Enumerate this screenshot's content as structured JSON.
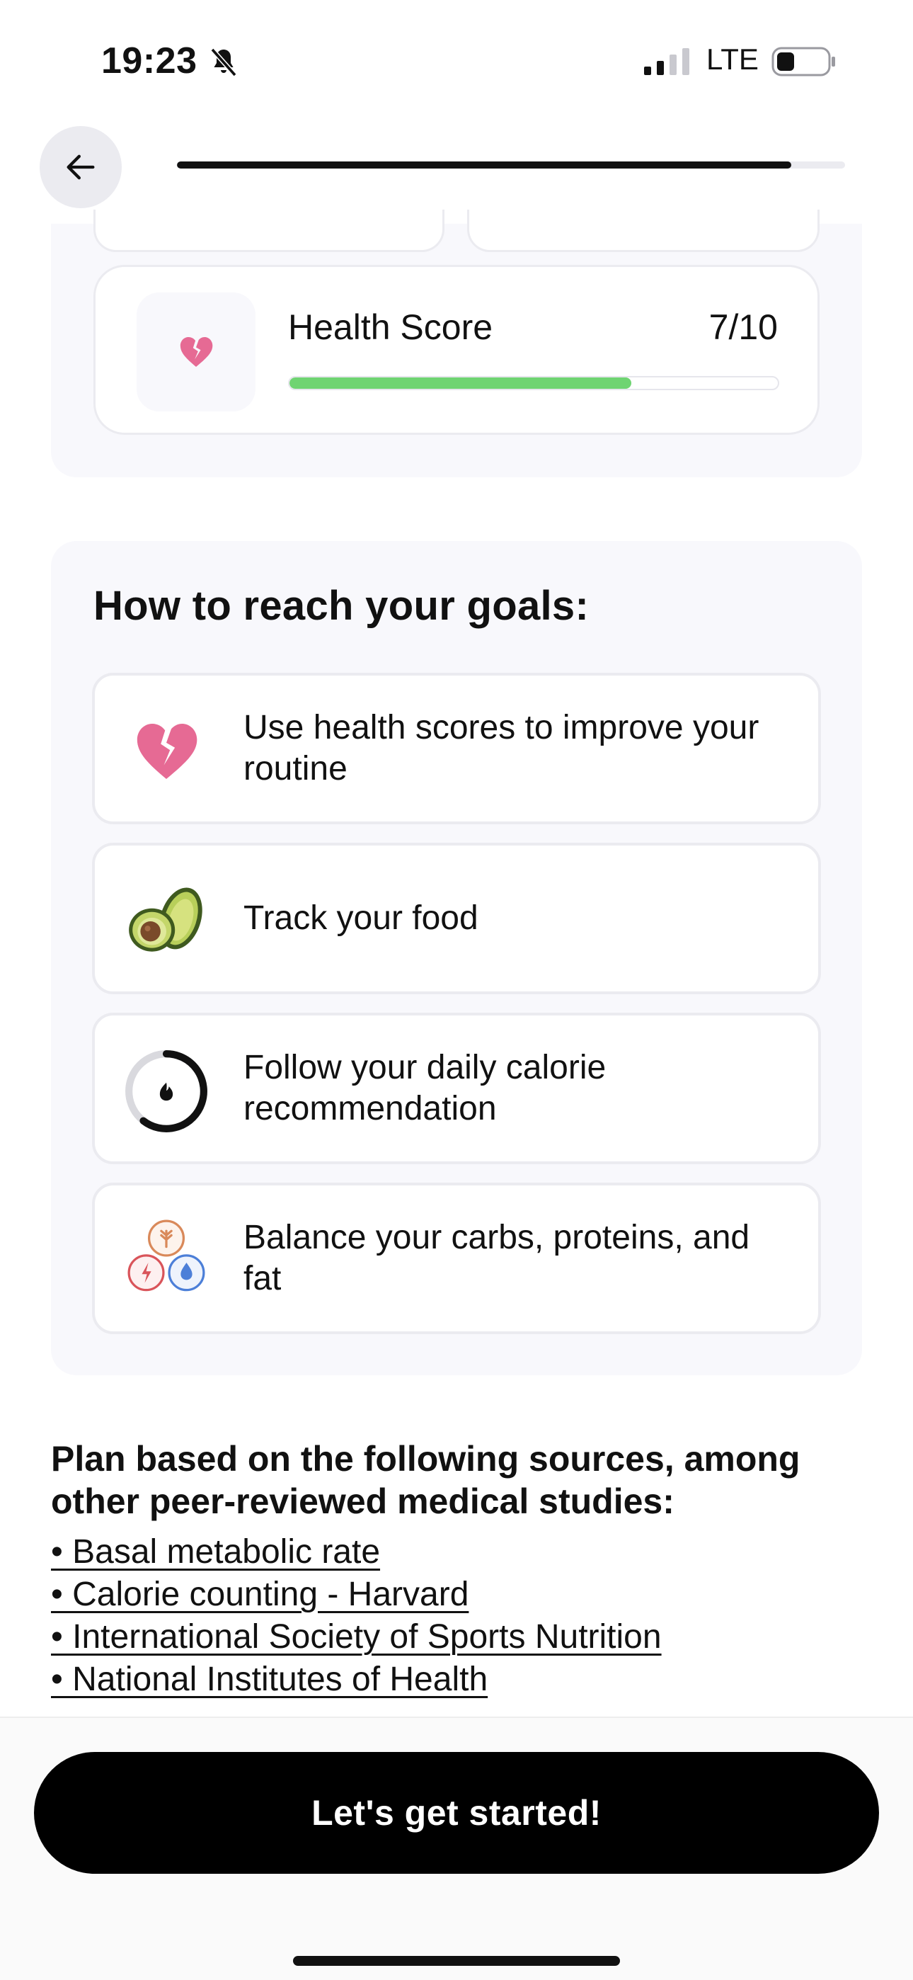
{
  "status_bar": {
    "time": "19:23",
    "network": "LTE",
    "icons": [
      "bell-slash-icon",
      "signal-icon",
      "battery-icon"
    ]
  },
  "header": {
    "back_icon": "arrow-left-icon",
    "progress": 0.92
  },
  "health_score": {
    "label": "Health Score",
    "value": "7/10",
    "fill": 0.7,
    "icon": "broken-heart-icon",
    "bar_color": "#6fd472"
  },
  "goals": {
    "title": "How to reach your goals:",
    "items": [
      {
        "icon": "broken-heart-icon",
        "text": "Use health scores to improve your routine"
      },
      {
        "icon": "avocado-icon",
        "text": "Track your food"
      },
      {
        "icon": "calorie-ring-icon",
        "text": "Follow your daily calorie recommendation"
      },
      {
        "icon": "macros-icon",
        "text": "Balance your carbs, proteins, and fat"
      }
    ]
  },
  "sources": {
    "title": "Plan based on the following sources, among other peer-reviewed medical studies:",
    "links": [
      "• Basal metabolic rate",
      "• Calorie counting - Harvard",
      "• International Society of Sports Nutrition",
      "• National Institutes of Health"
    ]
  },
  "cta": {
    "label": "Let's get started!"
  },
  "colors": {
    "accent_pink": "#e66a94",
    "panel_bg": "#f8f8fc",
    "button_bg": "#000000"
  }
}
